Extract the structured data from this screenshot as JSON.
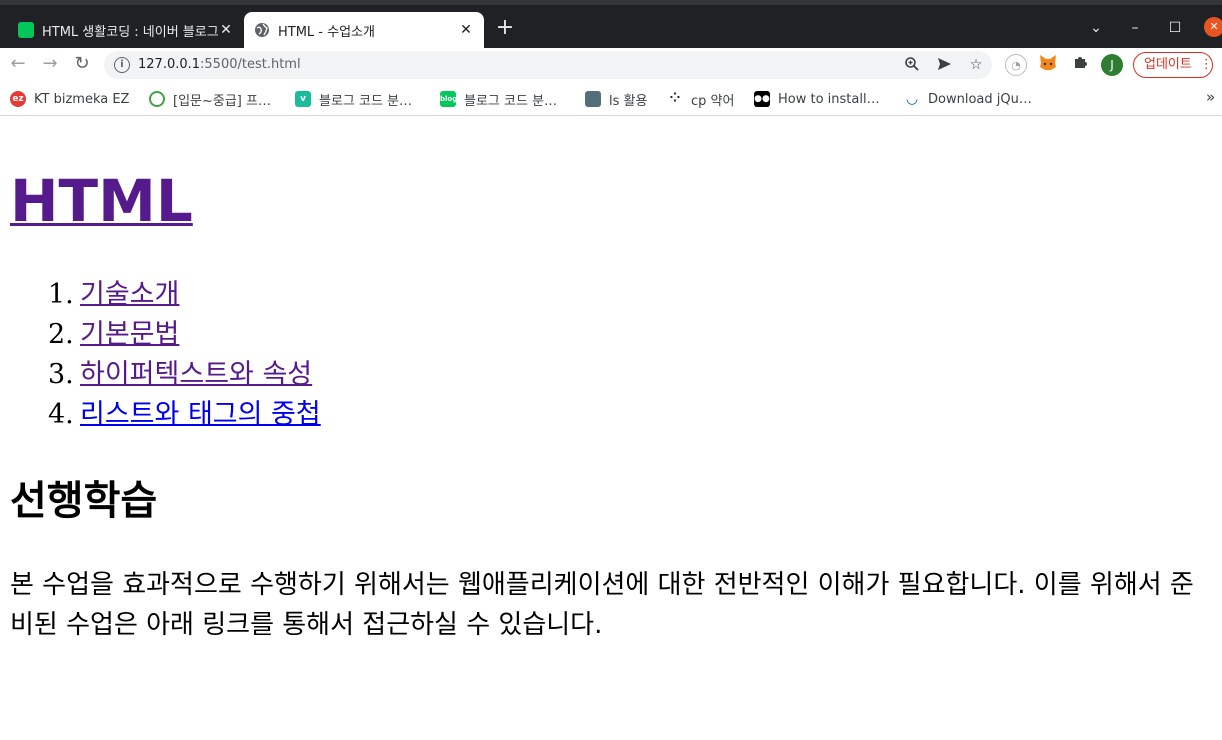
{
  "browser": {
    "tabs": [
      {
        "title": "HTML 생활코딩 : 네이버 블로그",
        "favicon": "naver-blog-icon",
        "active": false
      },
      {
        "title": "HTML - 수업소개",
        "favicon": "globe-icon",
        "active": true
      }
    ],
    "new_tab": "+",
    "window_controls": {
      "dropdown": "⌄",
      "minimize": "–",
      "maximize": "☐",
      "close": "✕"
    },
    "nav": {
      "back": "←",
      "forward": "→",
      "reload": "↻"
    },
    "address": {
      "host": "127.0.0.1",
      "port_path": ":5500/test.html"
    },
    "omnibox_icons": [
      "zoom-icon",
      "send-icon",
      "star-icon"
    ],
    "extensions": [
      "extension-icon",
      "metamask-icon",
      "puzzle-icon"
    ],
    "profile_initial": "J",
    "update_label": "업데이트",
    "bookmarks": [
      {
        "label": "KT bizmeka EZ",
        "icon": "ez-icon",
        "color": "#e53935"
      },
      {
        "label": "[입문~중급] 프…",
        "icon": "course-icon",
        "color": "#43a047"
      },
      {
        "label": "블로그 코드 분…",
        "icon": "v-icon",
        "color": "#1abc9c"
      },
      {
        "label": "블로그 코드 분…",
        "icon": "blog-icon",
        "color": "#03c75a"
      },
      {
        "label": "ls 활용",
        "icon": "terminal-icon",
        "color": "#546e7a"
      },
      {
        "label": "cp 약어",
        "icon": "dots-icon",
        "color": "#212121"
      },
      {
        "label": "How to install…",
        "icon": "medium-icon",
        "color": "#000000"
      },
      {
        "label": "Download jQu…",
        "icon": "jquery-icon",
        "color": "#0769ad"
      }
    ],
    "bookmarks_more": "»"
  },
  "page": {
    "title": "HTML",
    "list": [
      {
        "num": "1.",
        "label": "기술소개",
        "visited": true
      },
      {
        "num": "2.",
        "label": "기본문법",
        "visited": true
      },
      {
        "num": "3.",
        "label": "하이퍼텍스트와 속성",
        "visited": true
      },
      {
        "num": "4.",
        "label": "리스트와 태그의 중첩",
        "visited": false
      }
    ],
    "heading": "선행학습",
    "paragraph": "본 수업을 효과적으로 수행하기 위해서는 웹애플리케이션에 대한 전반적인 이해가 필요합니다. 이를 위해서 준비된 수업은 아래 링크를 통해서 접근하실 수 있습니다."
  },
  "colors": {
    "visited_link": "#551a8b",
    "link": "#0000ee",
    "update": "#d93025"
  }
}
